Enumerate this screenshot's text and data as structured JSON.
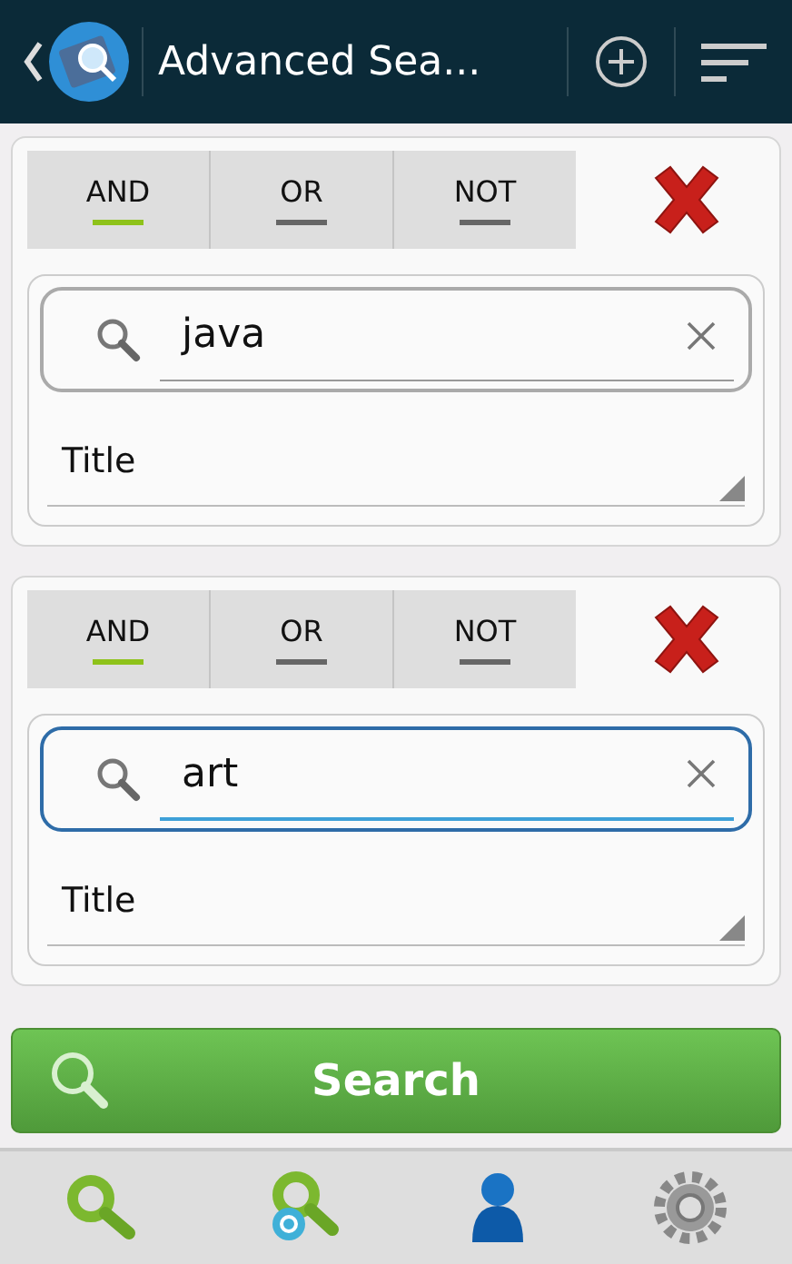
{
  "app_bar": {
    "title": "Advanced Sea..."
  },
  "criteria": [
    {
      "operators": [
        {
          "label": "AND",
          "selected": true
        },
        {
          "label": "OR",
          "selected": false
        },
        {
          "label": "NOT",
          "selected": false
        }
      ],
      "query": "java",
      "focused": false,
      "field": "Title"
    },
    {
      "operators": [
        {
          "label": "AND",
          "selected": true
        },
        {
          "label": "OR",
          "selected": false
        },
        {
          "label": "NOT",
          "selected": false
        }
      ],
      "query": "art",
      "focused": true,
      "field": "Title"
    }
  ],
  "search_button": {
    "label": "Search"
  },
  "bottom_nav": [
    {
      "kind": "search"
    },
    {
      "kind": "email-search"
    },
    {
      "kind": "account"
    },
    {
      "kind": "settings"
    }
  ]
}
